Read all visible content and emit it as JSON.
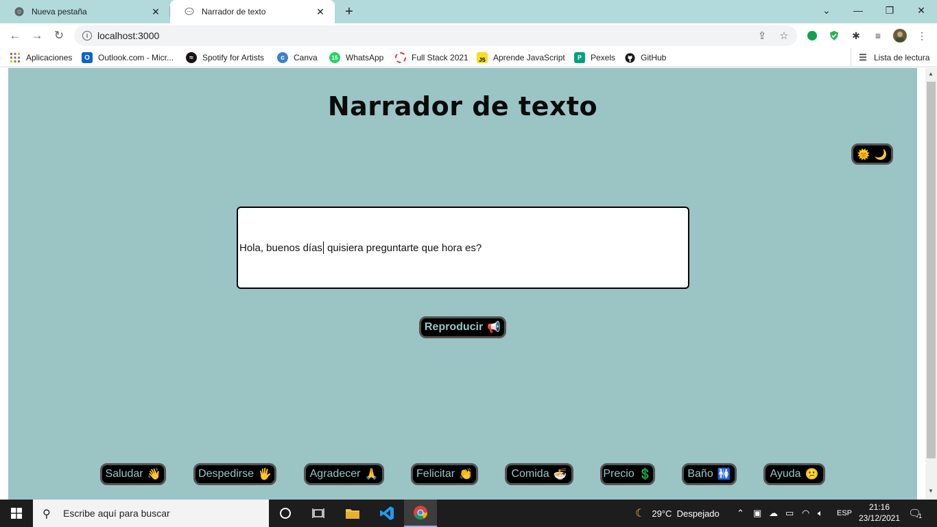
{
  "browser": {
    "tabs": [
      {
        "title": "Nueva pestaña",
        "icon": "chrome-icon",
        "active": false
      },
      {
        "title": "Narrador de texto",
        "icon": "chat-bubble-icon",
        "active": true
      }
    ],
    "address": "localhost:3000",
    "bookmarks": [
      {
        "label": "Aplicaciones",
        "icon": "apps-grid-icon"
      },
      {
        "label": "Outlook.com - Micr...",
        "icon": "outlook-icon"
      },
      {
        "label": "Spotify for Artists",
        "icon": "spotify-icon"
      },
      {
        "label": "Canva",
        "icon": "canva-icon"
      },
      {
        "label": "WhatsApp",
        "icon": "whatsapp-icon"
      },
      {
        "label": "Full Stack 2021",
        "icon": "fullstack-icon"
      },
      {
        "label": "Aprende JavaScript",
        "icon": "js-icon"
      },
      {
        "label": "Pexels",
        "icon": "pexels-icon"
      },
      {
        "label": "GitHub",
        "icon": "github-icon"
      }
    ],
    "reading_list": "Lista de lectura"
  },
  "page": {
    "title": "Narrador de texto",
    "theme_toggle": {
      "sun": "🌞",
      "moon": "🌙"
    },
    "textarea": {
      "before_caret": "Hola, buenos días",
      "after_caret": " quisiera preguntarte que hora es?"
    },
    "play_button": {
      "label": "Reproducir",
      "emoji": "📢"
    },
    "quick_phrases": [
      {
        "label": "Saludar",
        "emoji": "👋"
      },
      {
        "label": "Despedirse",
        "emoji": "🖐"
      },
      {
        "label": "Agradecer",
        "emoji": "🙏"
      },
      {
        "label": "Felicitar",
        "emoji": "👏"
      },
      {
        "label": "Comida",
        "emoji": "🍜"
      },
      {
        "label": "Precio",
        "emoji": "💲"
      },
      {
        "label": "Baño",
        "emoji": "🚻"
      },
      {
        "label": "Ayuda",
        "emoji": "😕"
      }
    ],
    "colors": {
      "background": "#9bc4c5",
      "button": "#000000",
      "button_text": "#9bc4c5"
    }
  },
  "taskbar": {
    "search_placeholder": "Escribe aquí para buscar",
    "weather": "29°C  Despejado",
    "language": "ESP",
    "time": "21:16",
    "date": "23/12/2021",
    "notifications": "1"
  }
}
